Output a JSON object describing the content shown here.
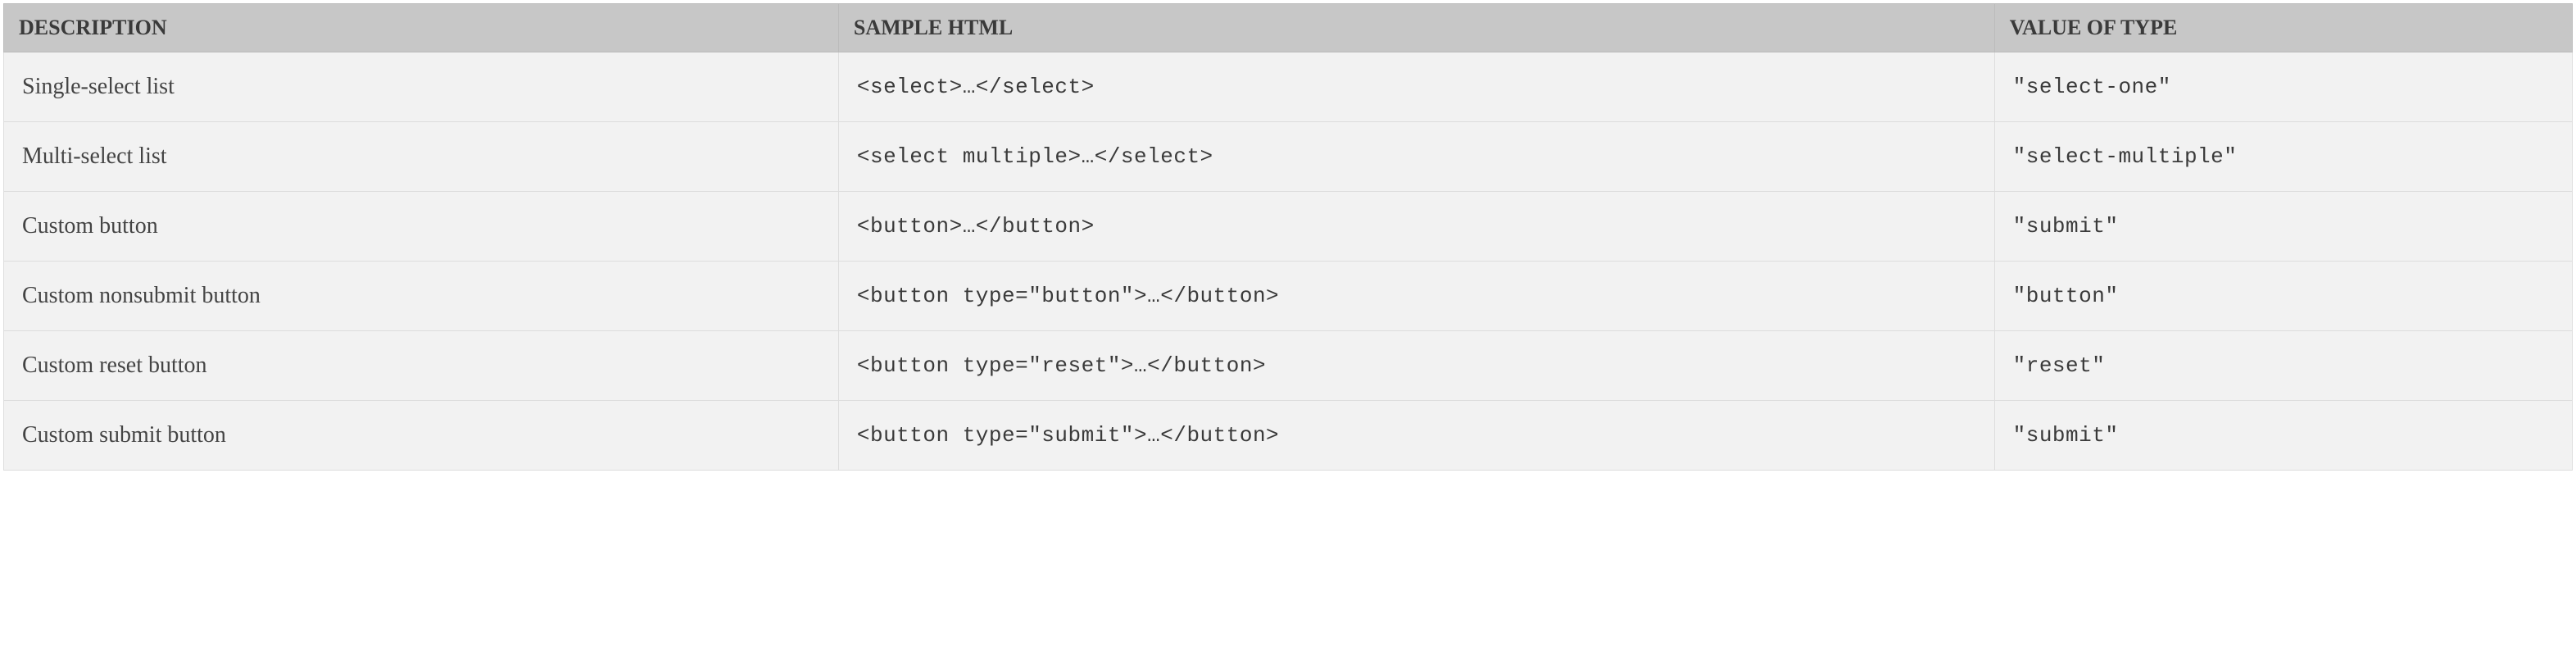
{
  "table": {
    "headers": {
      "description": "DESCRIPTION",
      "sample_html": "SAMPLE HTML",
      "value_of_type": "VALUE OF TYPE"
    },
    "rows": [
      {
        "description": "Single-select list",
        "sample_html": "<select>…</select>",
        "value_of_type": "\"select-one\""
      },
      {
        "description": "Multi-select list",
        "sample_html": "<select multiple>…</select>",
        "value_of_type": "\"select-multiple\""
      },
      {
        "description": "Custom button",
        "sample_html": "<button>…</button>",
        "value_of_type": "\"submit\""
      },
      {
        "description": "Custom nonsubmit button",
        "sample_html": "<button type=\"button\">…</button>",
        "value_of_type": "\"button\""
      },
      {
        "description": "Custom reset button",
        "sample_html": "<button type=\"reset\">…</button>",
        "value_of_type": "\"reset\""
      },
      {
        "description": "Custom submit button",
        "sample_html": "<button type=\"submit\">…</button>",
        "value_of_type": "\"submit\""
      }
    ]
  }
}
